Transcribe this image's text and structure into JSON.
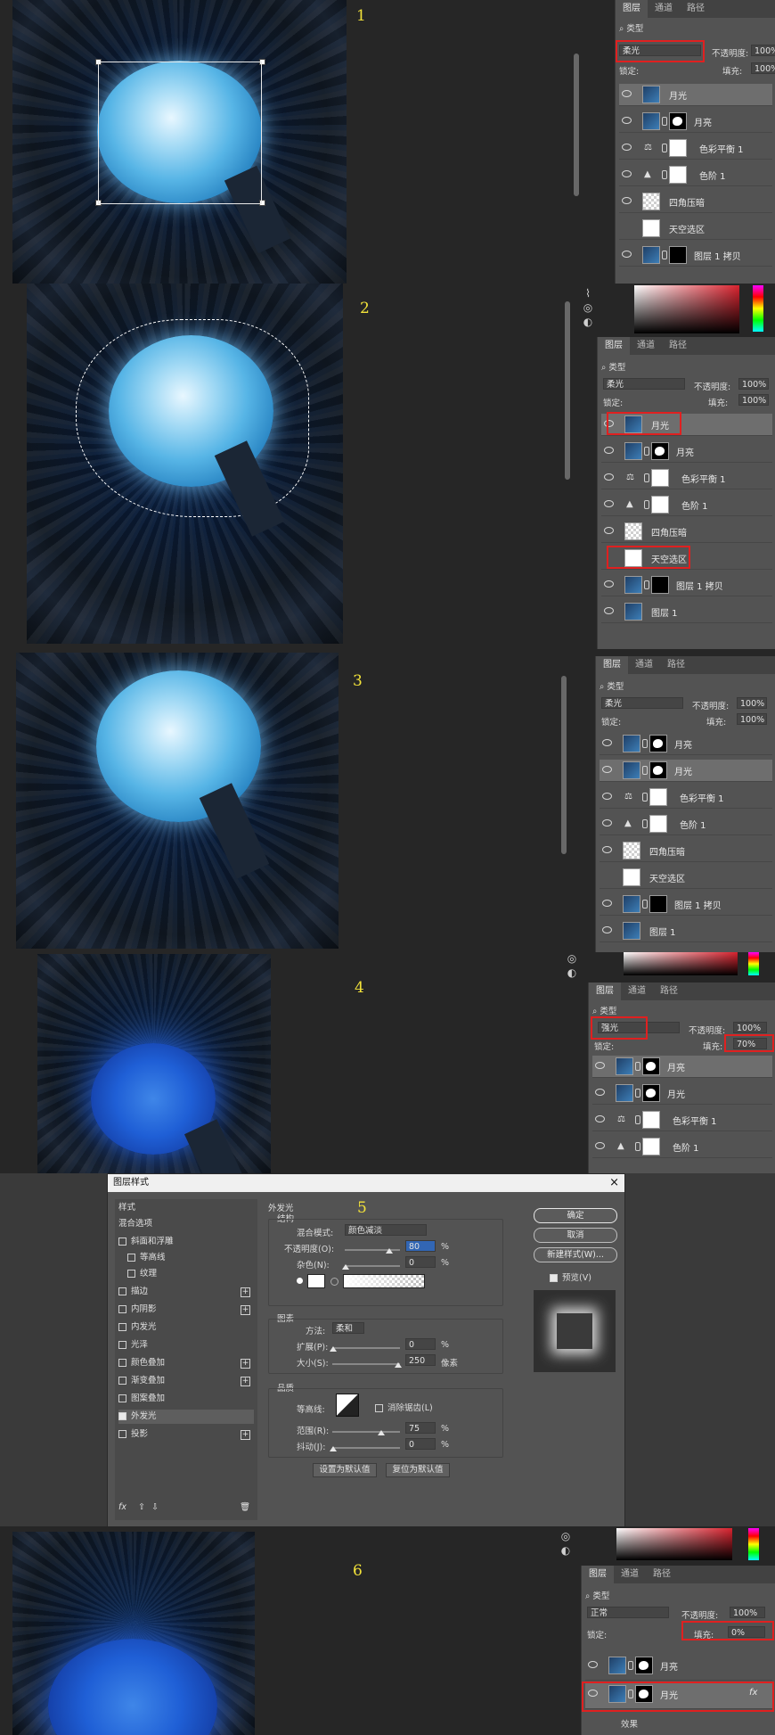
{
  "steps": [
    "1",
    "2",
    "3",
    "4",
    "5",
    "6"
  ],
  "panel": {
    "tabs": [
      "图层",
      "通道",
      "路径"
    ],
    "filter": "类型",
    "opacity_label": "不透明度:",
    "lock_label": "锁定:",
    "fill_label": "填充:"
  },
  "step1": {
    "blend": "柔光",
    "opacity": "100%",
    "fill": "100%",
    "layers": [
      "月光",
      "月亮",
      "色彩平衡 1",
      "色阶 1",
      "四角压暗",
      "天空选区",
      "图层 1 拷贝"
    ]
  },
  "step2": {
    "blend": "柔光",
    "opacity": "100%",
    "fill": "100%",
    "layers": [
      "月光",
      "月亮",
      "色彩平衡 1",
      "色阶 1",
      "四角压暗",
      "天空选区",
      "图层 1 拷贝",
      "图层 1"
    ]
  },
  "step3": {
    "blend": "柔光",
    "opacity": "100%",
    "fill": "100%",
    "layers": [
      "月亮",
      "月光",
      "色彩平衡 1",
      "色阶 1",
      "四角压暗",
      "天空选区",
      "图层 1 拷贝",
      "图层 1"
    ]
  },
  "step4": {
    "blend": "强光",
    "opacity": "100%",
    "fill": "70%",
    "layers": [
      "月亮",
      "月光",
      "色彩平衡 1",
      "色阶 1"
    ]
  },
  "dialog": {
    "title": "图层样式",
    "close": "×",
    "styles": [
      "样式",
      "混合选项",
      "斜面和浮雕",
      "等高线",
      "纹理",
      "描边",
      "内阴影",
      "内发光",
      "光泽",
      "颜色叠加",
      "渐变叠加",
      "图案叠加",
      "外发光",
      "投影"
    ],
    "fx": "fx",
    "section": "外发光",
    "structure": "结构",
    "blend_mode_label": "混合模式:",
    "blend_mode": "颜色减淡",
    "opacity_label": "不透明度(O):",
    "opacity": "80",
    "noise_label": "杂色(N):",
    "noise": "0",
    "elements": "图素",
    "technique_label": "方法:",
    "technique": "柔和",
    "spread_label": "扩展(P):",
    "spread": "0",
    "size_label": "大小(S):",
    "size": "250",
    "quality": "品质",
    "contour_label": "等高线:",
    "antialias": "消除锯齿(L)",
    "range_label": "范围(R):",
    "range": "75",
    "jitter_label": "抖动(J):",
    "jitter": "0",
    "percent": "%",
    "pixels": "像素",
    "make_default": "设置为默认值",
    "reset_default": "复位为默认值",
    "ok": "确定",
    "cancel": "取消",
    "new_style": "新建样式(W)...",
    "preview": "预览(V)"
  },
  "step6": {
    "blend": "正常",
    "opacity": "100%",
    "fill": "0%",
    "layers": [
      "月亮",
      "月光"
    ],
    "effect_label": "效果",
    "fx": "fx"
  }
}
